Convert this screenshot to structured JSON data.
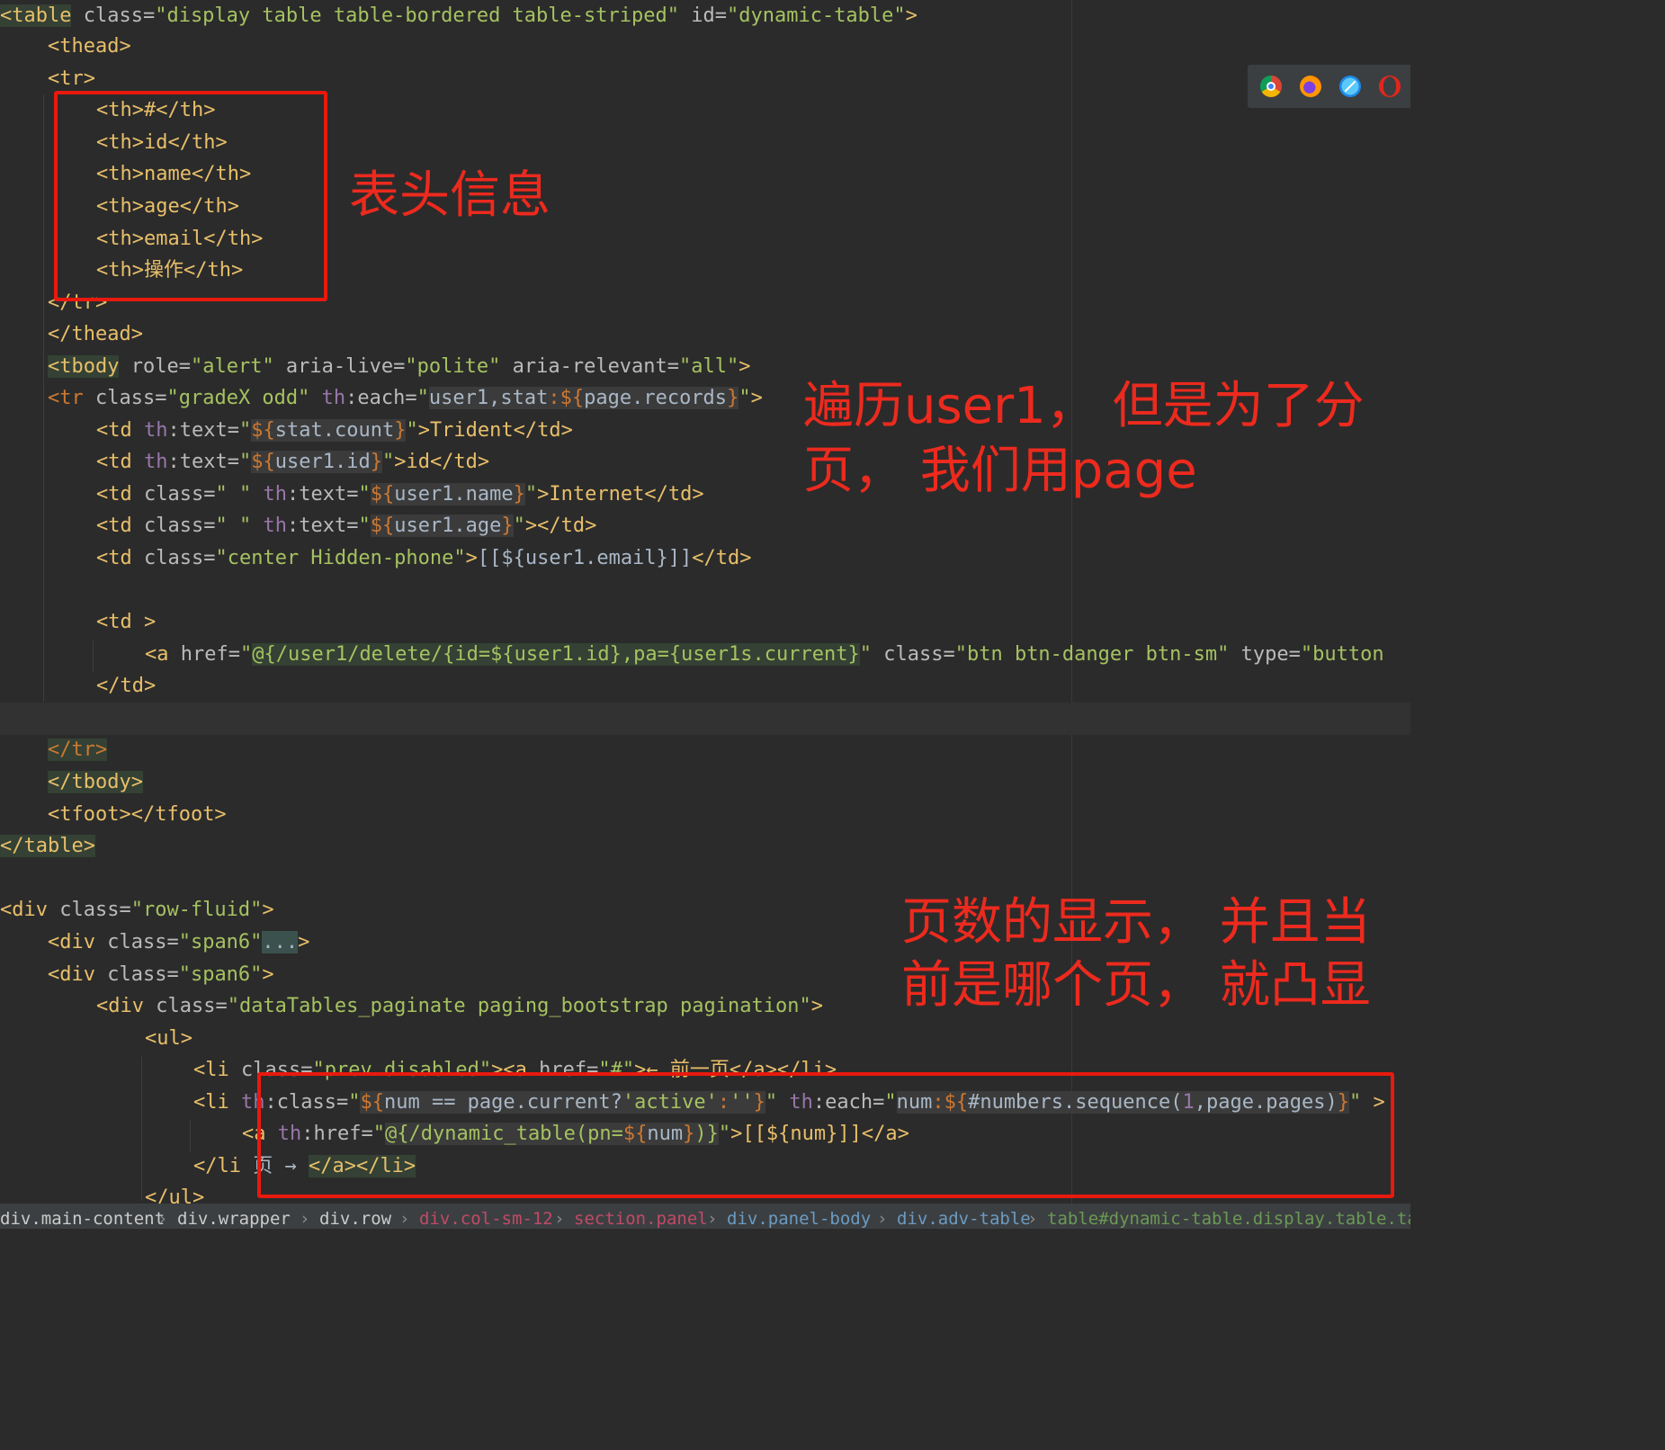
{
  "annotations": {
    "header_info": "表头信息",
    "iterate_line1": "遍历user1，  但是为了分",
    "iterate_line2": "页，  我们用page",
    "pagination_line1": "页数的显示，  并且当",
    "pagination_line2": "前是哪个页，  就凸显"
  },
  "browser_icons": [
    "chrome-icon",
    "firefox-icon",
    "safari-icon",
    "opera-icon"
  ],
  "breadcrumb": [
    "div.main-content",
    "div.wrapper",
    "div.row",
    "div.col-sm-12",
    "section.panel",
    "div.panel-body",
    "div.adv-table",
    "table#dynamic-table.display.table.table-b"
  ],
  "colors": {
    "background": "#2b2b2b",
    "tag": "#e8bf6a",
    "attribute": "#bababa",
    "string": "#a5c261",
    "annotation": "#ec2a1e"
  },
  "code": {
    "l1": {
      "a": "<table",
      "b": " class=",
      "c": "\"display table table-bordered table-striped\"",
      "d": " id=",
      "e": "\"dynamic-table\"",
      "f": ">"
    },
    "l2": "<thead>",
    "l3": "<tr>",
    "l4": "<th>#</th>",
    "l5": "<th>id</th>",
    "l6": "<th>name</th>",
    "l7": "<th>age</th>",
    "l8": "<th>email</th>",
    "l9": "<th>操作</th>",
    "l10": "</tr>",
    "l11": "</thead>",
    "l12": {
      "a": "<tbody",
      "b": " role=",
      "c": "\"alert\"",
      "d": " aria-live=",
      "e": "\"polite\"",
      "f": " aria-relevant=",
      "g": "\"all\"",
      "h": ">"
    },
    "l13": {
      "a": "<tr",
      "b": " class=",
      "c": "\"gradeX odd\"",
      "d": " th",
      "e": ":each=",
      "f": "\"",
      "g": "user1,stat",
      "h": ":",
      "i": "${",
      "j": "page.records",
      "k": "}",
      "l": "\"",
      "m": ">"
    },
    "l14": {
      "a": "<td",
      "b": " th",
      "c": ":text=",
      "d": "\"",
      "e": "${",
      "f": "stat.count",
      "g": "}",
      "h": "\"",
      "i": ">Trident</td>"
    },
    "l15": {
      "a": "<td",
      "b": " th",
      "c": ":text=",
      "d": "\"",
      "e": "${",
      "f": "user1.id",
      "g": "}",
      "h": "\"",
      "i": ">id</td>"
    },
    "l16": {
      "a": "<td",
      "b": " class=",
      "c": "\" \"",
      "d": " th",
      "e": ":text=",
      "f": "\"",
      "g": "${",
      "h": "user1.name",
      "i": "}",
      "j": "\"",
      "k": ">Internet</td>"
    },
    "l17": {
      "a": "<td",
      "b": " class=",
      "c": "\" \"",
      "d": " th",
      "e": ":text=",
      "f": "\"",
      "g": "${",
      "h": "user1.age",
      "i": "}",
      "j": "\"",
      "k": "></td>"
    },
    "l18": {
      "a": "<td",
      "b": " class=",
      "c": "\"center Hidden-phone\"",
      "d": ">",
      "e": "[[${user1.email}]]",
      "f": "</td>"
    },
    "l19": "<td >",
    "l20": {
      "a": "<a",
      "b": " href=",
      "c": "\"",
      "d": "@{/user1/delete/{id=${user1.id},pa={user1s.current}",
      "e": "\"",
      "f": " class=",
      "g": "\"btn btn-danger btn-sm\"",
      "h": " type=",
      "i": "\"button"
    },
    "l21": "</td>",
    "l22": "</tr>",
    "l23": "</tbody>",
    "l24": {
      "a": "<tfoot>",
      "b": "</tfoot>"
    },
    "l25": "</table>",
    "l26": {
      "a": "<div",
      "b": " class=",
      "c": "\"row-fluid\"",
      "d": ">"
    },
    "l27": {
      "a": "<div",
      "b": " class=",
      "c": "\"span6\"",
      "d": "...",
      "e": ">"
    },
    "l28": {
      "a": "<div",
      "b": " class=",
      "c": "\"span6\"",
      "d": ">"
    },
    "l29": {
      "a": "<div",
      "b": " class=",
      "c": "\"dataTables_paginate paging_bootstrap pagination\"",
      "d": ">"
    },
    "l30": "<ul>",
    "l31": {
      "a": "<li",
      "b": " class=",
      "c": "\"prev disabled\"",
      "d": "><a",
      "e": " href=",
      "f": "\"#\"",
      "g": ">← 前一页</a></li>"
    },
    "l32": {
      "a": "<li",
      "b": " th",
      "c": ":class=",
      "d": "\"",
      "e": "${",
      "f": "num == page.current?",
      "g": "'active'",
      "h": ":",
      "i": "''",
      "j": "}",
      "k": "\"",
      "l": " th",
      "m": ":each=",
      "n": "\"",
      "o": "num",
      "p": ":",
      "q": "${",
      "r": "#numbers.sequence(",
      "s": "1",
      "t": ",page.pages)",
      "u": "}",
      "v": "\"",
      "w": " >"
    },
    "l33": {
      "a": "<a",
      "b": " th",
      "c": ":href=",
      "d": "\"",
      "e": "@{/",
      "f": "dynamic_table(pn=",
      "g": "${",
      "h": "num",
      "i": "}",
      "j": ")}",
      "k": "\"",
      "l": ">[[${num}]]</a>"
    },
    "l34": {
      "a": "</li",
      "b": " 页 → ",
      "c": "</a></li>"
    },
    "l35": "</ul>"
  }
}
